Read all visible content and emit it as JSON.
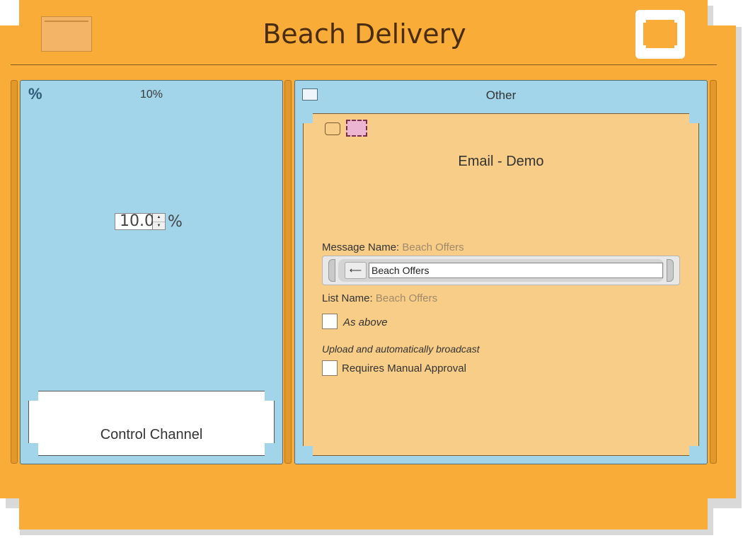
{
  "window": {
    "title": "Beach Delivery"
  },
  "left_panel": {
    "title": "10%",
    "icon": "percent-icon",
    "icon_glyph": "%",
    "percentage_value": "10.0",
    "percentage_unit": "%",
    "card_label": "Control Channel"
  },
  "right_panel": {
    "title": "Other",
    "card": {
      "title": "Email - Demo",
      "message_name_label": "Message Name:",
      "message_name_value": "Beach Offers",
      "input_value": "Beach Offers",
      "back_glyph": "⟵",
      "list_name_label": "List Name:",
      "list_name_value": "Beach Offers",
      "as_above_label": "As above",
      "upload_note": "Upload and automatically broadcast",
      "manual_approval_label": "Requires Manual Approval"
    }
  },
  "colors": {
    "window_bg": "#f9ad38",
    "panel_blue": "#a2d4ea",
    "card_peach": "#f8cd88",
    "title_brown": "#4a2d10"
  }
}
